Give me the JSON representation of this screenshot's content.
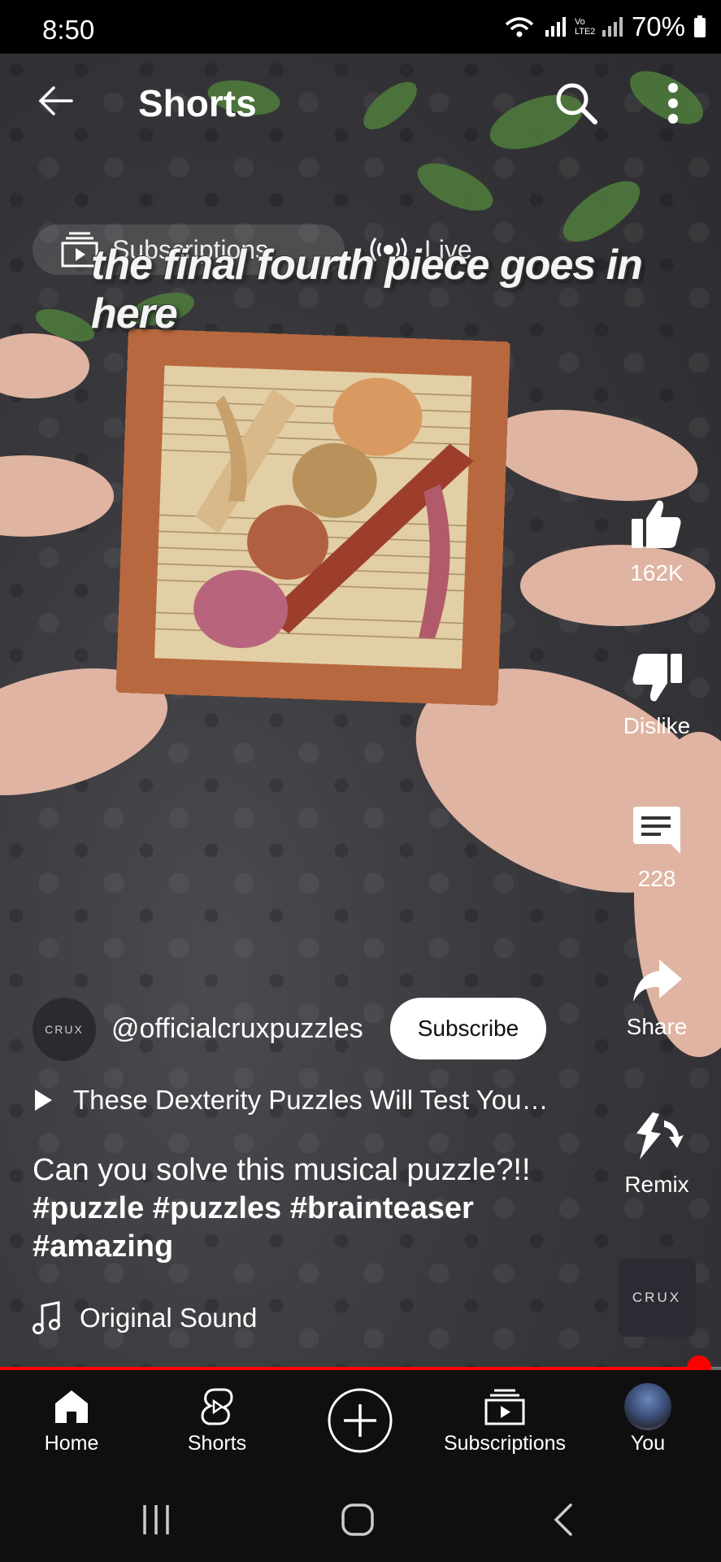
{
  "status_bar": {
    "time": "8:50",
    "network_label": "Vo LTE2",
    "battery": "70%"
  },
  "header": {
    "title": "Shorts"
  },
  "feed_chips": [
    {
      "label": "Subscriptions",
      "icon": "subscriptions-icon"
    },
    {
      "label": "Live",
      "icon": "live-icon"
    }
  ],
  "video": {
    "caption": "the final fourth piece goes in here",
    "progress_fraction": 0.97
  },
  "actions": {
    "like_count": "162K",
    "dislike_label": "Dislike",
    "comment_count": "228",
    "share_label": "Share",
    "remix_label": "Remix",
    "sound_thumb_text": "CRUX"
  },
  "channel": {
    "avatar_text": "CRUX",
    "handle": "@officialcruxpuzzles",
    "subscribe_label": "Subscribe"
  },
  "related_video": {
    "title": "These Dexterity Puzzles Will Test You…"
  },
  "description": {
    "text": "Can you solve this musical puzzle?!!",
    "hashtags_line1": "#puzzle #puzzles #brainteaser",
    "hashtags_line2": "#amazing"
  },
  "sound": {
    "label": "Original Sound"
  },
  "bottom_nav": {
    "home": "Home",
    "shorts": "Shorts",
    "subscriptions": "Subscriptions",
    "you": "You"
  },
  "colors": {
    "accent": "#ff0000",
    "background": "#0f0f0f",
    "wood": "#b8683e"
  }
}
